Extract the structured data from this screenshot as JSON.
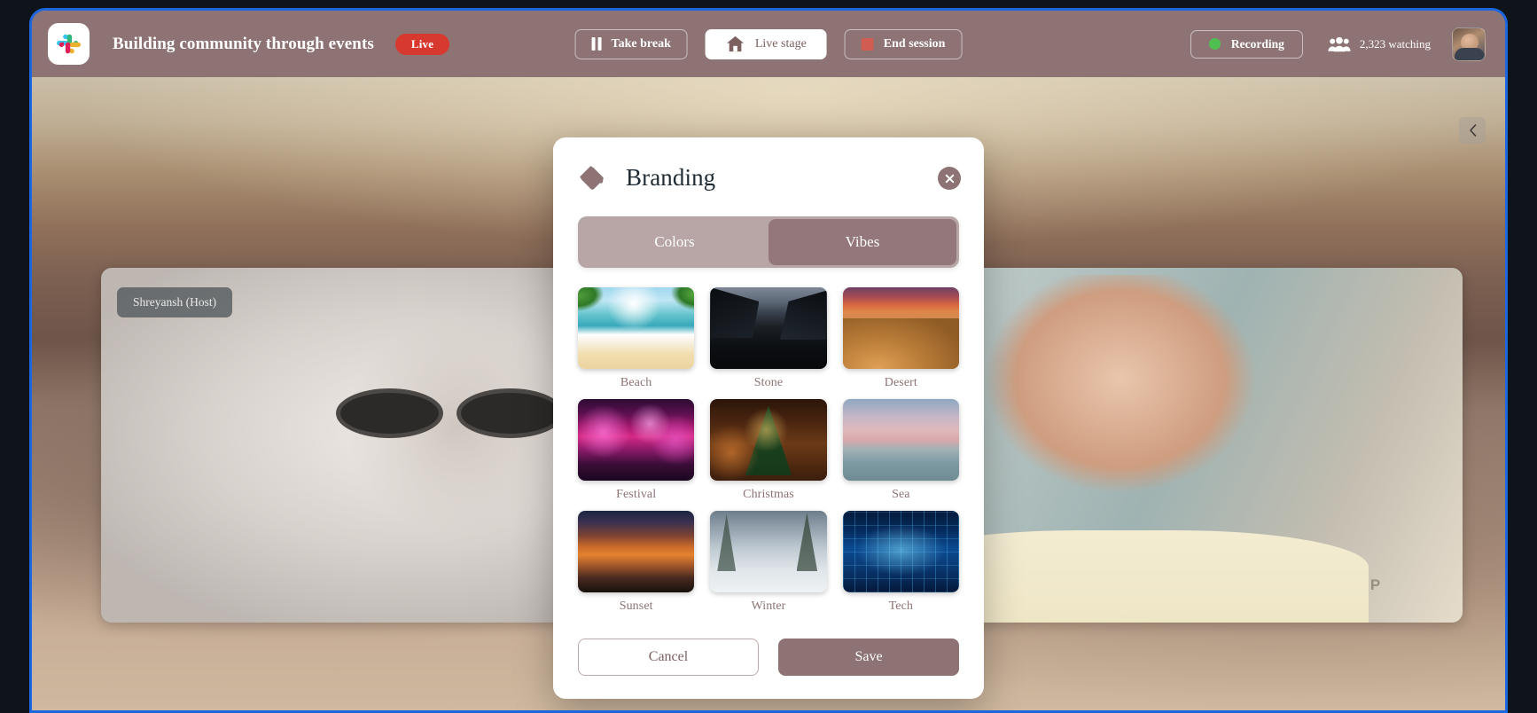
{
  "header": {
    "logo_icon": "slack-logo-icon",
    "event_title": "Building community through events",
    "live_badge": "Live",
    "take_break_label": "Take break",
    "take_break_icon": "pause-icon",
    "live_stage_label": "Live stage",
    "live_stage_icon": "home-icon",
    "end_session_label": "End session",
    "end_session_icon": "stop-square-icon",
    "recording_label": "Recording",
    "recording_dot_color": "#4fc04f",
    "people_icon": "people-icon",
    "watching_count": "2,323 watching",
    "avatar_icon": "user-avatar"
  },
  "stage": {
    "collapse_icon": "chevron-left-icon",
    "host_chip": "Shreyansh (Host)",
    "shirt_text": "STOP"
  },
  "modal": {
    "title": "Branding",
    "brand_icon": "paint-bucket-icon",
    "close_icon": "close-circle-icon",
    "tabs": [
      {
        "label": "Colors",
        "active": false
      },
      {
        "label": "Vibes",
        "active": true
      }
    ],
    "vibes": [
      {
        "label": "Beach",
        "art": "th-beach"
      },
      {
        "label": "Stone",
        "art": "th-stone"
      },
      {
        "label": "Desert",
        "art": "th-desert"
      },
      {
        "label": "Festival",
        "art": "th-festival"
      },
      {
        "label": "Christmas",
        "art": "th-christmas"
      },
      {
        "label": "Sea",
        "art": "th-sea"
      },
      {
        "label": "Sunset",
        "art": "th-sunset"
      },
      {
        "label": "Winter",
        "art": "th-winter"
      },
      {
        "label": "Tech",
        "art": "th-tech"
      }
    ],
    "cancel_label": "Cancel",
    "save_label": "Save"
  },
  "theme": {
    "accent": "#8d7374",
    "live_red": "#d8392f",
    "tab_track": "#b8a6a6",
    "tab_active": "#93777a",
    "browser_border": "#1c66e0"
  }
}
